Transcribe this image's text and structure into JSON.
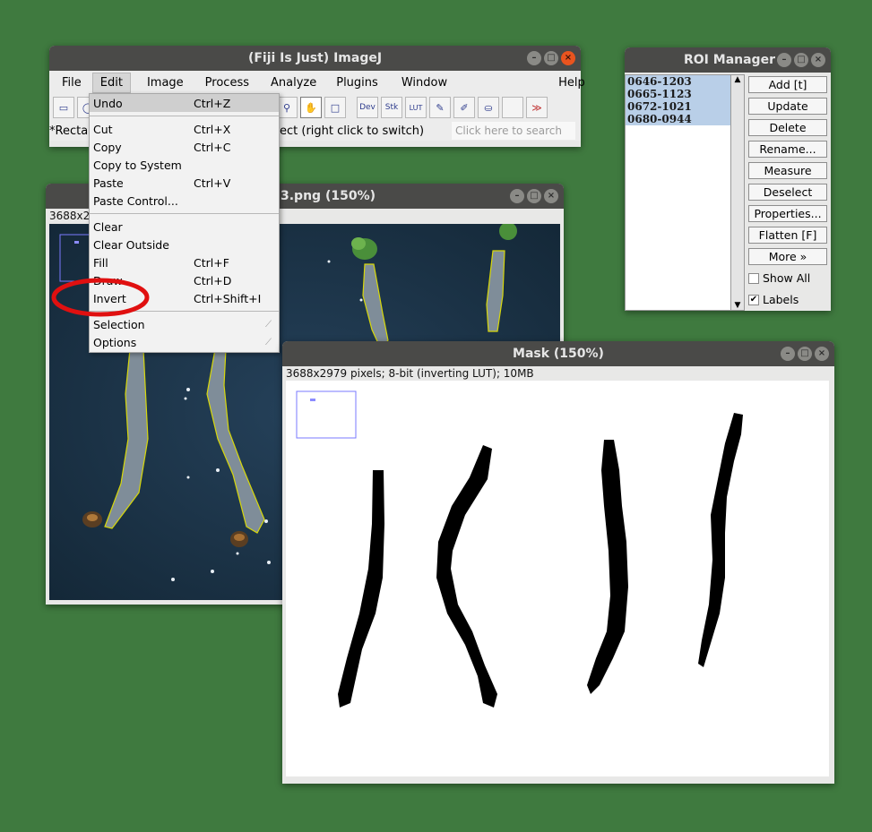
{
  "imagej": {
    "title": "(Fiji Is Just) ImageJ",
    "menus": [
      "File",
      "Edit",
      "Image",
      "Process",
      "Analyze",
      "Plugins",
      "Window",
      "Help"
    ],
    "toolbar": {
      "dev": "Dev",
      "stk": "Stk",
      "lut": "LUT",
      "more": "≫"
    },
    "status": "*Recta",
    "status_right": "ect (right click to switch)",
    "search_placeholder": "Click here to search"
  },
  "edit_menu": {
    "items": [
      {
        "label": "Undo",
        "shortcut": "Ctrl+Z"
      },
      {
        "label": "Cut",
        "shortcut": "Ctrl+X"
      },
      {
        "label": "Copy",
        "shortcut": "Ctrl+C"
      },
      {
        "label": "Copy to System",
        "shortcut": ""
      },
      {
        "label": "Paste",
        "shortcut": "Ctrl+V"
      },
      {
        "label": "Paste Control...",
        "shortcut": ""
      },
      {
        "label": "Clear",
        "shortcut": ""
      },
      {
        "label": "Clear Outside",
        "shortcut": ""
      },
      {
        "label": "Fill",
        "shortcut": "Ctrl+F"
      },
      {
        "label": "Draw",
        "shortcut": "Ctrl+D"
      },
      {
        "label": "Invert",
        "shortcut": "Ctrl+Shift+I"
      },
      {
        "label": "Selection",
        "shortcut": ""
      },
      {
        "label": "Options",
        "shortcut": ""
      }
    ]
  },
  "image_window": {
    "title": "3.png (150%)",
    "info": "3688x2"
  },
  "roi_manager": {
    "title": "ROI Manager",
    "items": [
      "0646-1203",
      "0665-1123",
      "0672-1021",
      "0680-0944"
    ],
    "buttons": [
      "Add [t]",
      "Update",
      "Delete",
      "Rename...",
      "Measure",
      "Deselect",
      "Properties...",
      "Flatten [F]",
      "More »"
    ],
    "show_all": "Show All",
    "labels": "Labels"
  },
  "mask_window": {
    "title": "Mask (150%)",
    "info": "3688x2979 pixels; 8-bit (inverting LUT); 10MB"
  }
}
